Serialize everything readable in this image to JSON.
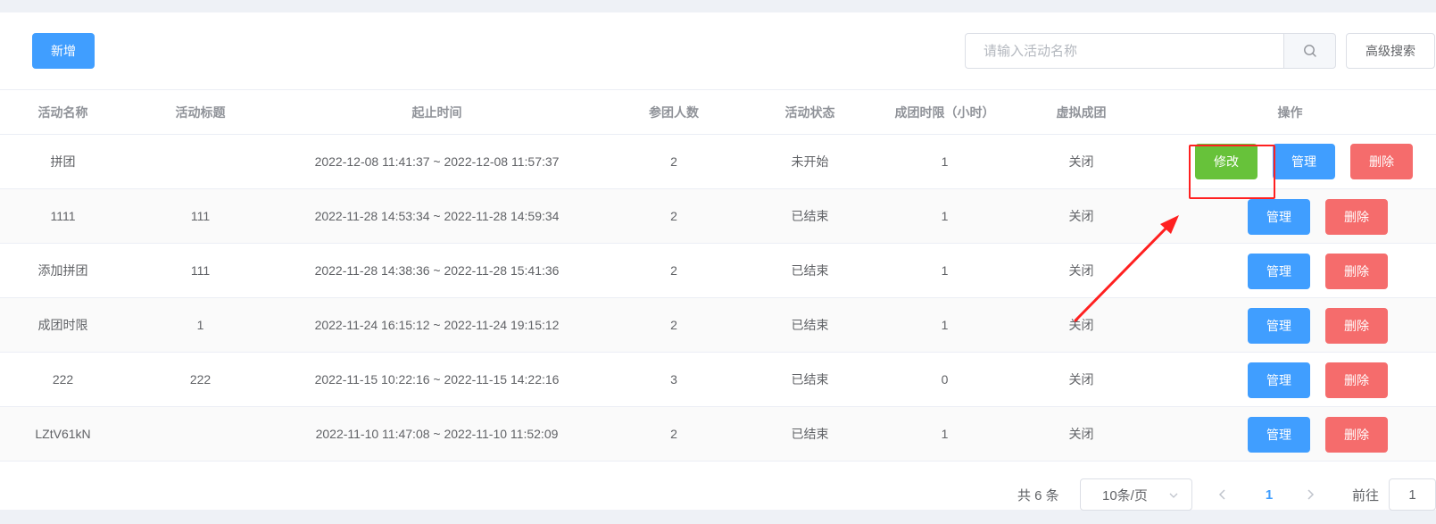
{
  "toolbar": {
    "add_label": "新增",
    "search_placeholder": "请输入活动名称",
    "search_value": "",
    "advanced_label": "高级搜索"
  },
  "table": {
    "headers": [
      "活动名称",
      "活动标题",
      "起止时间",
      "参团人数",
      "活动状态",
      "成团时限（小时）",
      "虚拟成团",
      "操作"
    ],
    "rows": [
      {
        "name": "拼团",
        "title": "",
        "time": "2022-12-08 11:41:37 ~ 2022-12-08 11:57:37",
        "members": "2",
        "status": "未开始",
        "limit": "1",
        "virtual": "关闭",
        "actions": [
          "修改",
          "管理",
          "删除"
        ]
      },
      {
        "name": "1111",
        "title": "111",
        "time": "2022-11-28 14:53:34 ~ 2022-11-28 14:59:34",
        "members": "2",
        "status": "已结束",
        "limit": "1",
        "virtual": "关闭",
        "actions": [
          "管理",
          "删除"
        ]
      },
      {
        "name": "添加拼团",
        "title": "111",
        "time": "2022-11-28 14:38:36 ~ 2022-11-28 15:41:36",
        "members": "2",
        "status": "已结束",
        "limit": "1",
        "virtual": "关闭",
        "actions": [
          "管理",
          "删除"
        ]
      },
      {
        "name": "成团时限",
        "title": "1",
        "time": "2022-11-24 16:15:12 ~ 2022-11-24 19:15:12",
        "members": "2",
        "status": "已结束",
        "limit": "1",
        "virtual": "关闭",
        "actions": [
          "管理",
          "删除"
        ]
      },
      {
        "name": "222",
        "title": "222",
        "time": "2022-11-15 10:22:16 ~ 2022-11-15 14:22:16",
        "members": "3",
        "status": "已结束",
        "limit": "0",
        "virtual": "关闭",
        "actions": [
          "管理",
          "删除"
        ]
      },
      {
        "name": "LZtV61kN",
        "title": "",
        "time": "2022-11-10 11:47:08 ~ 2022-11-10 11:52:09",
        "members": "2",
        "status": "已结束",
        "limit": "1",
        "virtual": "关闭",
        "actions": [
          "管理",
          "删除"
        ]
      }
    ]
  },
  "pagination": {
    "total_label": "共 6 条",
    "page_size_label": "10条/页",
    "current_page": "1",
    "goto_label": "前往",
    "goto_value": "1"
  },
  "colors": {
    "primary": "#409eff",
    "success": "#67c23a",
    "danger": "#f56c6c",
    "annotation": "#ff2020"
  },
  "icons": [
    "search-icon",
    "chevron-down-icon",
    "chevron-left-icon",
    "chevron-right-icon",
    "arrow-annotation"
  ]
}
